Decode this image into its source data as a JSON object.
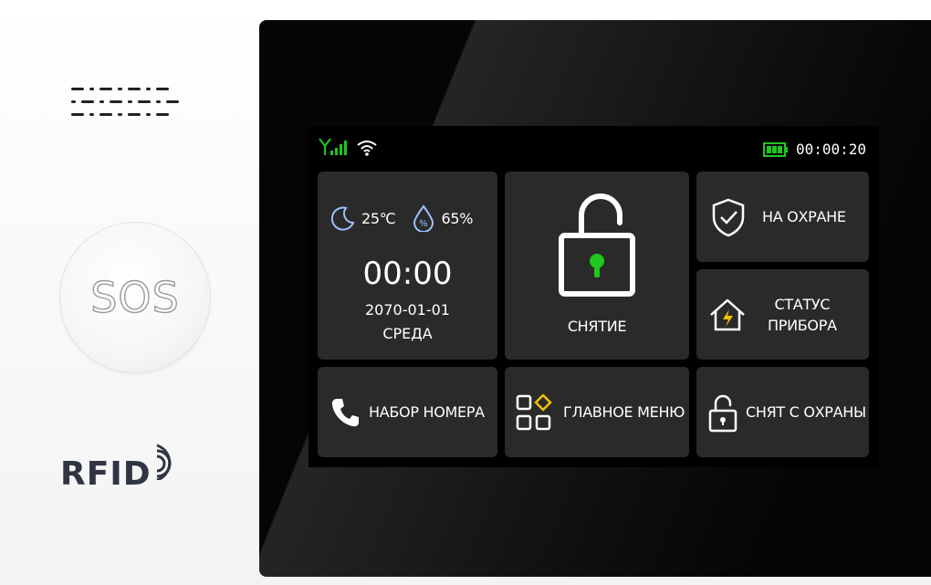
{
  "sos_button": {
    "label": "SOS"
  },
  "rfid_logo": {
    "label": "RFID"
  },
  "status_bar": {
    "signal_icon": "signal-bars-icon",
    "wifi_icon": "wifi-icon",
    "battery_icon": "battery-icon",
    "time": "00:00:20"
  },
  "weather_tile": {
    "temperature": "25℃",
    "humidity": "65%",
    "time": "00:00",
    "date": "2070-01-01",
    "weekday": "СРЕДА"
  },
  "tiles": {
    "disarm": {
      "label": "СНЯТИЕ",
      "icon": "unlock-icon"
    },
    "arm": {
      "label": "НА ОХРАНЕ",
      "icon": "shield-check-icon"
    },
    "status": {
      "line1": "СТАТУС",
      "line2": "ПРИБОРА",
      "icon": "home-bolt-icon"
    },
    "dial": {
      "label": "НАБОР НОМЕРА",
      "icon": "phone-icon"
    },
    "menu": {
      "label": "ГЛАВНОЕ МЕНЮ",
      "icon": "grid-menu-icon"
    },
    "disarmed": {
      "label": "СНЯТ С ОХРАНЫ",
      "icon": "padlock-icon"
    }
  },
  "colors": {
    "accent_green": "#1ec81e",
    "tile_bg": "#2a2a2a",
    "icon_yellow": "#f2c200",
    "icon_blue": "#9fc3ff"
  }
}
